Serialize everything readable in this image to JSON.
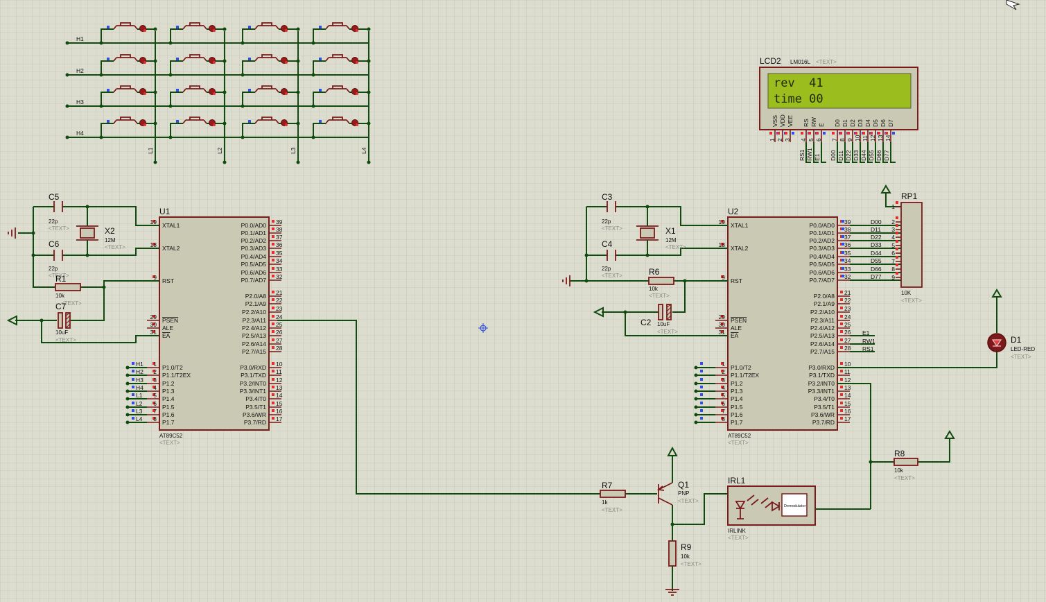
{
  "keypad": {
    "rows": [
      "H1",
      "H2",
      "H3",
      "H4"
    ],
    "cols": [
      "L1",
      "L2",
      "L3",
      "L4"
    ]
  },
  "placeholder": "<TEXT>",
  "mcu": {
    "left_pins": [
      {
        "num": "19",
        "name": "XTAL1"
      },
      {
        "num": "18",
        "name": "XTAL2"
      },
      {
        "num": "9",
        "name": "RST"
      },
      {
        "num": "29",
        "name": "PSEN"
      },
      {
        "num": "30",
        "name": "ALE"
      },
      {
        "num": "31",
        "name": "EA"
      },
      {
        "num": "1",
        "name": "P1.0/T2"
      },
      {
        "num": "2",
        "name": "P1.1/T2EX"
      },
      {
        "num": "3",
        "name": "P1.2"
      },
      {
        "num": "4",
        "name": "P1.3"
      },
      {
        "num": "5",
        "name": "P1.4"
      },
      {
        "num": "6",
        "name": "P1.5"
      },
      {
        "num": "7",
        "name": "P1.6"
      },
      {
        "num": "8",
        "name": "P1.7"
      }
    ],
    "right_pins": [
      {
        "num": "39",
        "name": "P0.0/AD0"
      },
      {
        "num": "38",
        "name": "P0.1/AD1"
      },
      {
        "num": "37",
        "name": "P0.2/AD2"
      },
      {
        "num": "36",
        "name": "P0.3/AD3"
      },
      {
        "num": "35",
        "name": "P0.4/AD4"
      },
      {
        "num": "34",
        "name": "P0.5/AD5"
      },
      {
        "num": "33",
        "name": "P0.6/AD6"
      },
      {
        "num": "32",
        "name": "P0.7/AD7"
      },
      {
        "num": "21",
        "name": "P2.0/A8"
      },
      {
        "num": "22",
        "name": "P2.1/A9"
      },
      {
        "num": "23",
        "name": "P2.2/A10"
      },
      {
        "num": "24",
        "name": "P2.3/A11"
      },
      {
        "num": "25",
        "name": "P2.4/A12"
      },
      {
        "num": "26",
        "name": "P2.5/A13"
      },
      {
        "num": "27",
        "name": "P2.6/A14"
      },
      {
        "num": "28",
        "name": "P2.7/A15"
      },
      {
        "num": "10",
        "name": "P3.0/RXD"
      },
      {
        "num": "11",
        "name": "P3.1/TXD"
      },
      {
        "num": "12",
        "name": "P3.2/INT0"
      },
      {
        "num": "13",
        "name": "P3.3/INT1"
      },
      {
        "num": "14",
        "name": "P3.4/T0"
      },
      {
        "num": "15",
        "name": "P3.5/T1"
      },
      {
        "num": "16",
        "name": "P3.6/WR"
      },
      {
        "num": "17",
        "name": "P3.7/RD"
      }
    ],
    "part": "AT89C52"
  },
  "u1": {
    "ref": "U1",
    "p1_nets": [
      "H1",
      "H2",
      "H3",
      "H4",
      "L1",
      "L2",
      "L3",
      "L4"
    ]
  },
  "u2": {
    "ref": "U2",
    "p0_nets": [
      "D00",
      "D11",
      "D22",
      "D33",
      "D44",
      "D55",
      "D66",
      "D77"
    ],
    "p2_nets": [
      "E1",
      "RW1",
      "RS1"
    ]
  },
  "left_circuit": {
    "c5": {
      "ref": "C5",
      "value": "22p"
    },
    "c6": {
      "ref": "C6",
      "value": "22p"
    },
    "x2": {
      "ref": "X2",
      "value": "12M"
    },
    "r1": {
      "ref": "R1",
      "value": "10k"
    },
    "c7": {
      "ref": "C7",
      "value": "10uF"
    }
  },
  "right_circuit": {
    "c3": {
      "ref": "C3",
      "value": "22p"
    },
    "c4": {
      "ref": "C4",
      "value": "22p"
    },
    "x1": {
      "ref": "X1",
      "value": "12M"
    },
    "r6": {
      "ref": "R6",
      "value": "10k"
    },
    "c2": {
      "ref": "C2",
      "value": "10uF"
    }
  },
  "lcd": {
    "ref": "LCD2",
    "part": "LM016L",
    "line1": "rev  41",
    "line2": "time 00",
    "pins": [
      "VSS",
      "VDD",
      "VEE",
      "RS",
      "RW",
      "E",
      "D0",
      "D1",
      "D2",
      "D3",
      "D4",
      "D5",
      "D6",
      "D7"
    ],
    "pin_nums": [
      "1",
      "2",
      "3",
      "4",
      "5",
      "6",
      "7",
      "8",
      "9",
      "10",
      "11",
      "12",
      "13",
      "14"
    ],
    "nets": [
      "RS1",
      "RW1",
      "E1",
      "D00",
      "D11",
      "D22",
      "D33",
      "D44",
      "D55",
      "D66",
      "D77"
    ]
  },
  "rp1": {
    "ref": "RP1",
    "value": "10K",
    "pins": [
      "1",
      "2",
      "3",
      "4",
      "5",
      "6",
      "7",
      "8",
      "9"
    ]
  },
  "d1": {
    "ref": "D1",
    "value": "LED-RED"
  },
  "r7": {
    "ref": "R7",
    "value": "1k"
  },
  "r8": {
    "ref": "R8",
    "value": "10k"
  },
  "r9": {
    "ref": "R9",
    "value": "10k"
  },
  "q1": {
    "ref": "Q1",
    "value": "PNP"
  },
  "irl": {
    "ref": "IRL1",
    "part": "IRLINK",
    "block": "Demodulator"
  }
}
